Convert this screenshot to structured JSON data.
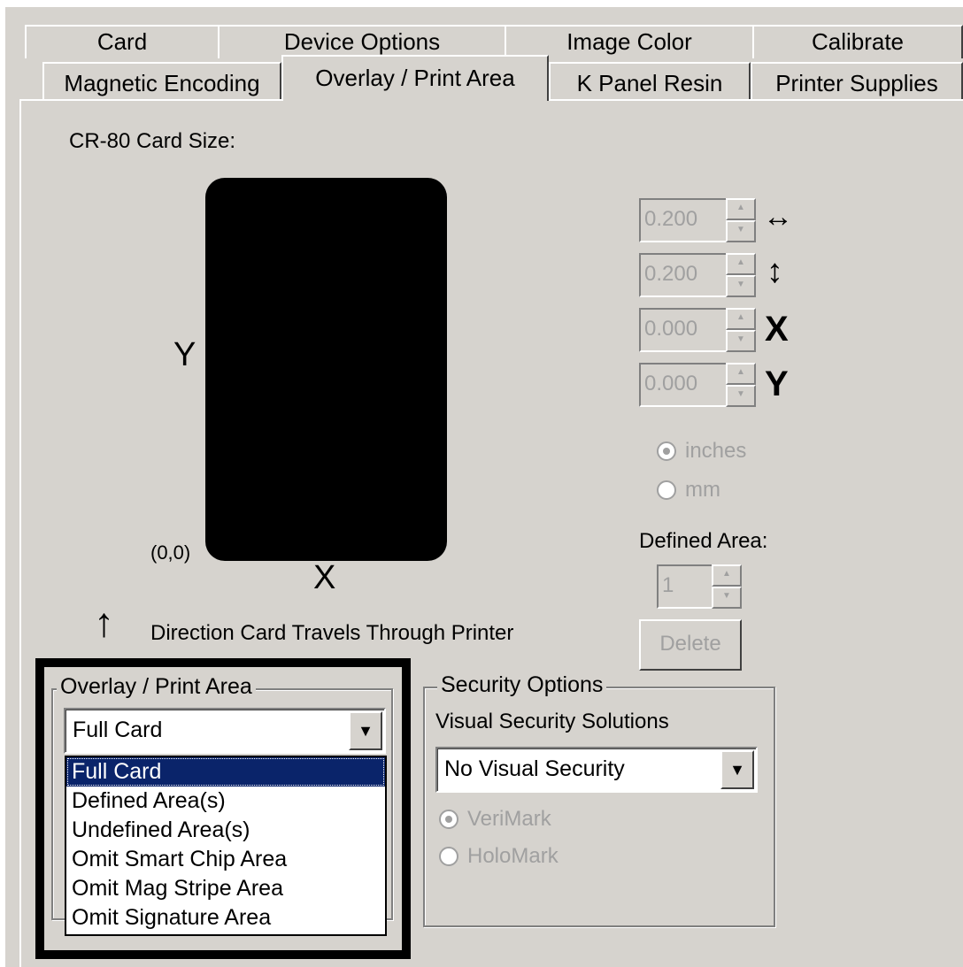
{
  "tabs_row1": [
    "Card",
    "Device Options",
    "Image Color",
    "Calibrate"
  ],
  "tabs_row2": [
    "Magnetic Encoding",
    "Overlay / Print Area",
    "K Panel Resin",
    "Printer Supplies"
  ],
  "card_size_label": "CR-80 Card Size:",
  "axis": {
    "y": "Y",
    "x": "X",
    "origin": "(0,0)"
  },
  "direction_arrow": "↑",
  "direction_label": "Direction Card Travels Through Printer",
  "spinners": [
    {
      "value": "0.200",
      "icon": "width-icon",
      "symbol": "↔"
    },
    {
      "value": "0.200",
      "icon": "height-icon",
      "symbol": "↕"
    },
    {
      "value": "0.000",
      "icon": "x-icon",
      "symbol": "X"
    },
    {
      "value": "0.000",
      "icon": "y-icon",
      "symbol": "Y"
    }
  ],
  "units": {
    "inches": "inches",
    "mm": "mm",
    "selected": "inches"
  },
  "defined_area": {
    "label": "Defined Area:",
    "value": "1"
  },
  "delete_button": "Delete",
  "overlay_group": {
    "title": "Overlay / Print Area",
    "selected": "Full Card",
    "options": [
      "Full Card",
      "Defined Area(s)",
      "Undefined Area(s)",
      "Omit Smart Chip Area",
      "Omit Mag Stripe Area",
      "Omit Signature Area"
    ]
  },
  "security_group": {
    "title": "Security Options",
    "subtitle": "Visual Security Solutions",
    "selected": "No Visual Security",
    "verimark": "VeriMark",
    "holomark": "HoloMark"
  },
  "colors": {
    "face": "#d6d3ce",
    "selection": "#0a246a",
    "disabled": "#a0a0a0"
  }
}
